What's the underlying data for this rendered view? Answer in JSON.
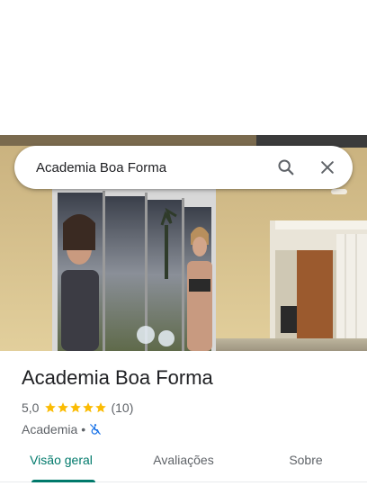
{
  "search": {
    "query": "Academia Boa Forma",
    "search_icon": "search-icon",
    "close_icon": "close-icon"
  },
  "place": {
    "name": "Academia Boa Forma",
    "rating": "5,0",
    "stars": 5,
    "review_count": "(10)",
    "category": "Academia",
    "separator": "•",
    "accessibility_icon": "not-wheelchair-accessible-icon"
  },
  "tabs": [
    {
      "label": "Visão geral",
      "active": true
    },
    {
      "label": "Avaliações",
      "active": false
    },
    {
      "label": "Sobre",
      "active": false
    }
  ],
  "colors": {
    "accent": "#00796b",
    "star": "#fbbc04",
    "icon_blue": "#1a73e8"
  }
}
